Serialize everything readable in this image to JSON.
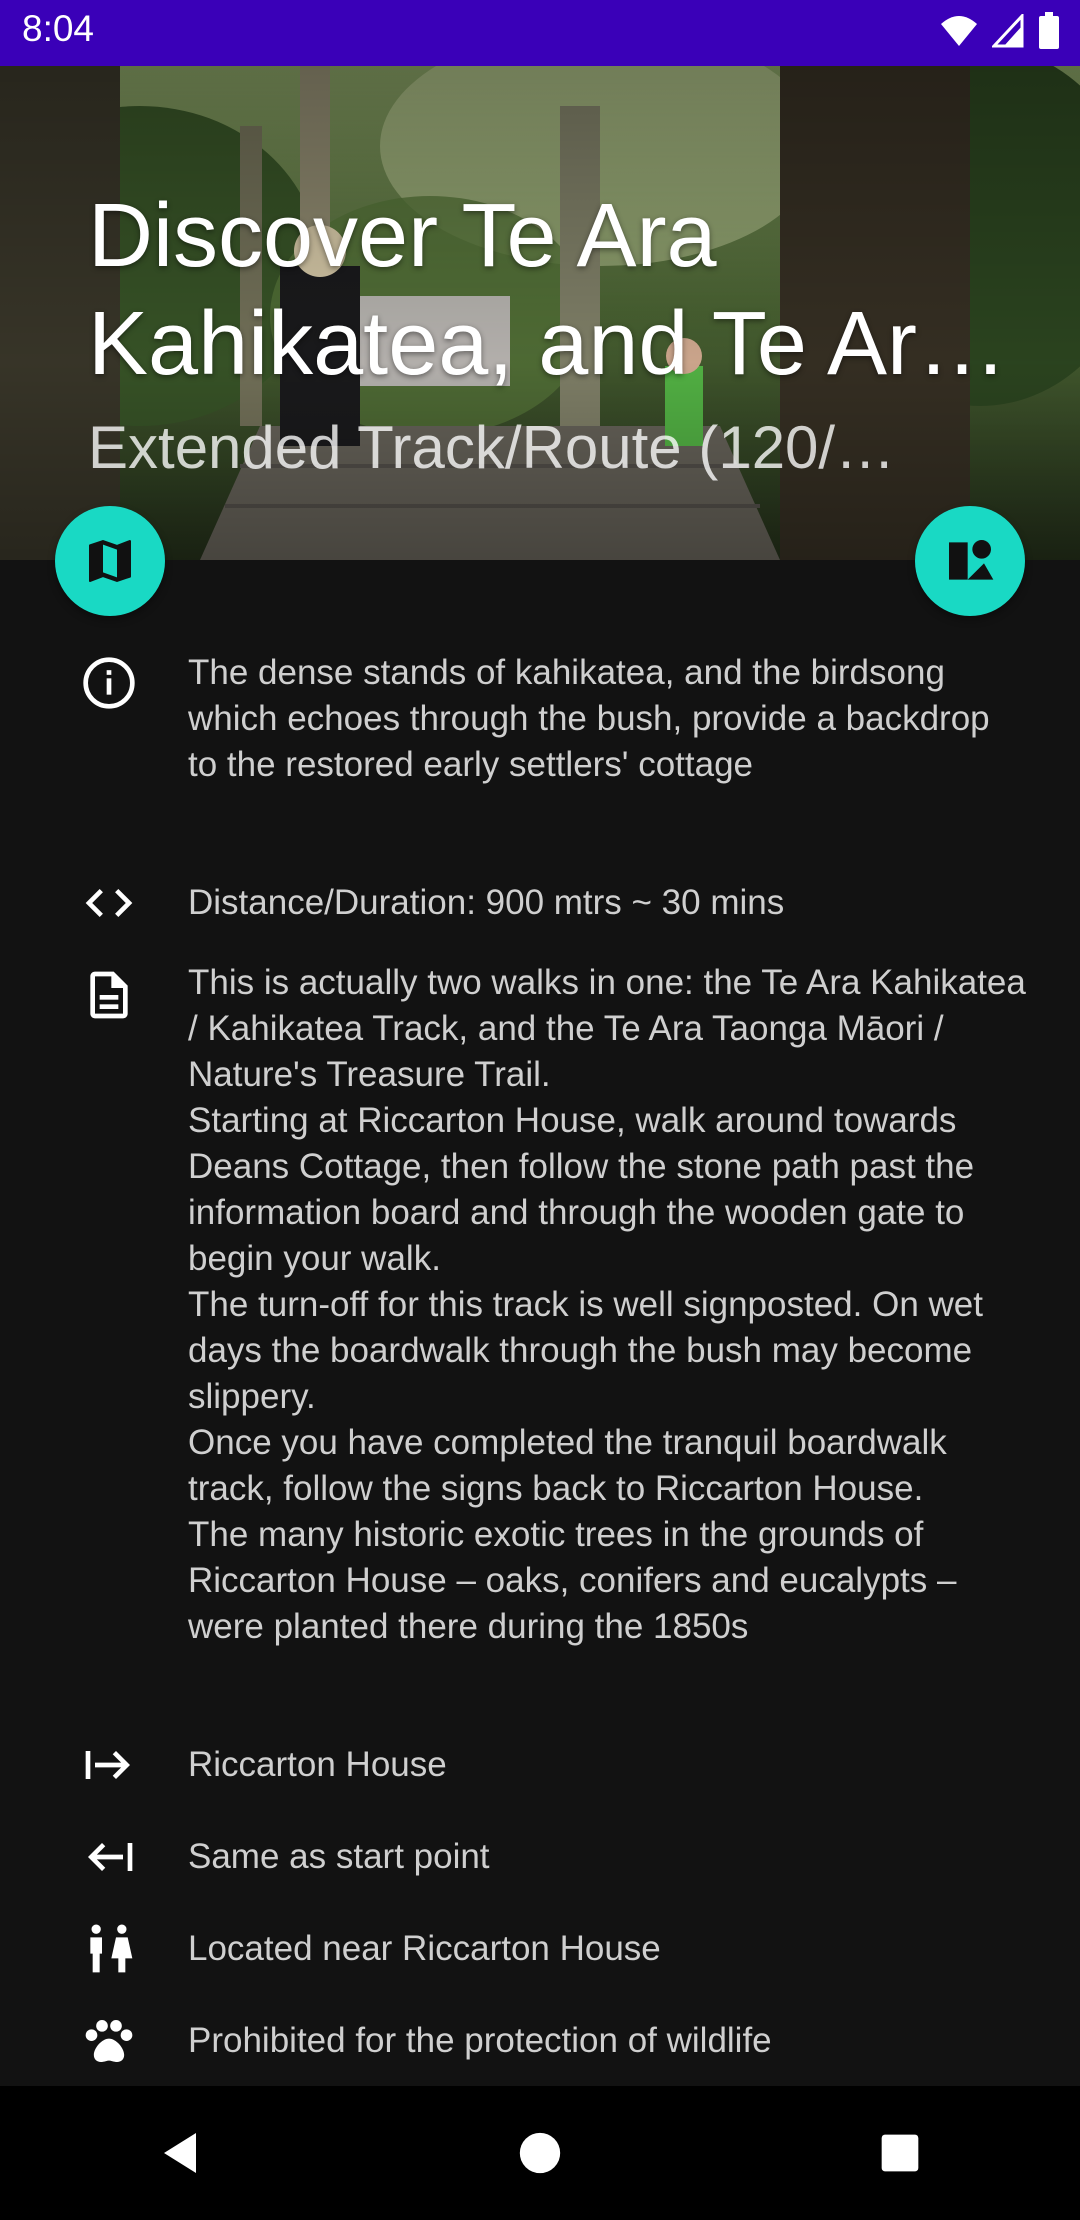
{
  "status_bar": {
    "time": "8:04"
  },
  "hero": {
    "title": "Discover Te Ara Kahikatea, and Te Ara Taonga Māori",
    "subtitle": "Extended Track/Route (120/…"
  },
  "fabs": {
    "map_icon": "map-icon",
    "poi_icon": "person-pin-icon"
  },
  "details": {
    "summary": "The dense stands of kahikatea, and the birdsong which echoes through the bush, provide a backdrop to the restored early settlers' cottage",
    "distance": "Distance/Duration: 900 mtrs ~ 30 mins",
    "description": "This is actually two walks in one: the Te Ara Kahikatea / Kahikatea Track, and the Te Ara Taonga Māori / Nature's Treasure Trail.\nStarting at Riccarton House, walk around towards Deans Cottage, then follow the stone path past the information board and through the wooden gate to begin your walk.\nThe turn-off for this track is well signposted. On wet days the boardwalk through the bush may become slippery.\nOnce you have completed the tranquil boardwalk track, follow the signs back to Riccarton House.\nThe many historic exotic trees in the grounds of Riccarton House – oaks, conifers and eucalypts – were planted there during the 1850s",
    "start_point": "Riccarton House",
    "end_point": "Same as start point",
    "toilets": "Located near Riccarton House",
    "dogs": "Prohibited for the protection of wildlife"
  },
  "colors": {
    "accent": "#19d9c4",
    "status_bar": "#3a00b8",
    "background": "#121212"
  }
}
